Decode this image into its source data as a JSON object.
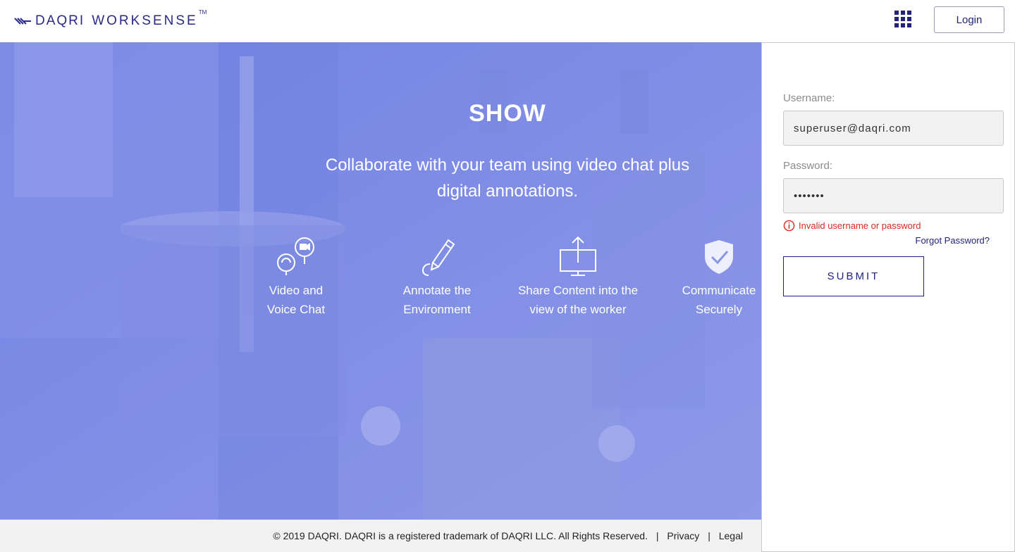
{
  "header": {
    "brand": "DAQRI",
    "product": "WORKSENSE",
    "trademark": "TM",
    "login_label": "Login"
  },
  "hero": {
    "title": "SHOW",
    "subtitle": "Collaborate with your team using video chat plus digital annotations.",
    "features": [
      {
        "label": "Video and\nVoice Chat",
        "icon": "video-voice-chat-icon"
      },
      {
        "label": "Annotate the\nEnvironment",
        "icon": "pen-icon"
      },
      {
        "label": "Share Content into the\nview of the worker",
        "icon": "share-screen-icon"
      },
      {
        "label": "Communicate\nSecurely",
        "icon": "shield-check-icon"
      }
    ]
  },
  "login": {
    "username_label": "Username:",
    "username_value": "superuser@daqri.com",
    "password_label": "Password:",
    "password_value": "•••••••",
    "error_text": "Invalid username or password",
    "forgot_label": "Forgot Password?",
    "submit_label": "SUBMIT"
  },
  "footer": {
    "copyright": "© 2019 DAQRI. DAQRI is a registered trademark of DAQRI LLC. All Rights Reserved.",
    "separator": "|",
    "privacy_label": "Privacy",
    "legal_label": "Legal"
  },
  "colors": {
    "brand_navy": "#23237e",
    "hero_overlay": "#7f8fe6",
    "error_red": "#e0281e"
  }
}
